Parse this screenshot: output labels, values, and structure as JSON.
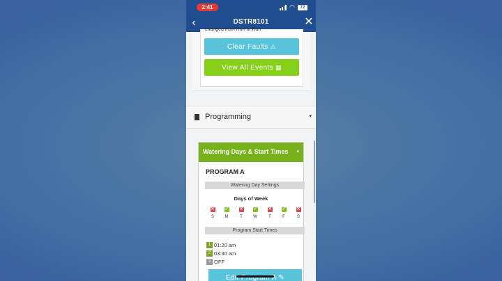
{
  "status_bar": {
    "time": "2:41",
    "battery": "72"
  },
  "nav": {
    "title": "DSTR8101",
    "back_icon": "‹",
    "close_icon": "✕"
  },
  "faults": {
    "message": "changed from Run to Run",
    "clear_label": "Clear Faults",
    "clear_icon": "⚠",
    "events_label": "View All Events",
    "events_icon": "▦"
  },
  "programming": {
    "label": "Programming",
    "caret": "▾"
  },
  "watering": {
    "header": "Watering Days & Start Times",
    "caret": "▾",
    "program_name": "PROGRAM A",
    "day_settings_label": "Watering Day Settings",
    "days_of_week_label": "Days of Week",
    "days": [
      {
        "letter": "S",
        "active": false,
        "mark": "✕"
      },
      {
        "letter": "M",
        "active": true,
        "mark": "✓"
      },
      {
        "letter": "T",
        "active": false,
        "mark": "✕"
      },
      {
        "letter": "W",
        "active": true,
        "mark": "✓"
      },
      {
        "letter": "T",
        "active": false,
        "mark": "✕"
      },
      {
        "letter": "F",
        "active": true,
        "mark": "✓"
      },
      {
        "letter": "S",
        "active": false,
        "mark": "✕"
      }
    ],
    "start_times_label": "Program Start Times",
    "start_times": [
      {
        "num": "1",
        "time": "01:20 am",
        "active": true
      },
      {
        "num": "2",
        "time": "03:30 am",
        "active": true
      },
      {
        "num": "3",
        "time": "OFF",
        "active": false
      }
    ],
    "edit_label": "Edit Program A",
    "edit_icon": "✎"
  },
  "colors": {
    "nav_blue": "#1f4d8f",
    "clear_cyan": "#58c4dc",
    "events_green": "#86d01a",
    "section_green": "#77b21c",
    "off_red": "#e0454a"
  }
}
